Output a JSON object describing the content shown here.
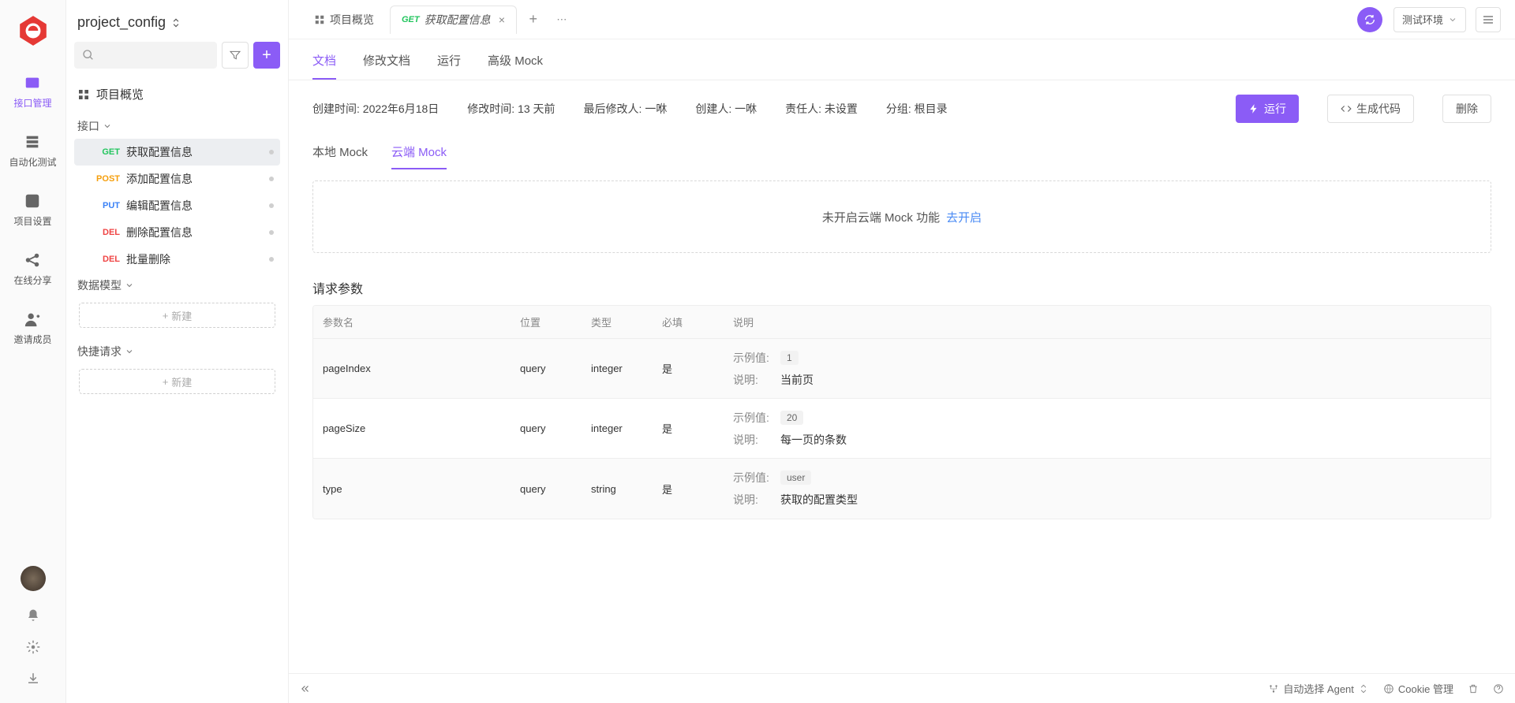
{
  "rail": {
    "items": [
      {
        "label": "接口管理"
      },
      {
        "label": "自动化测试"
      },
      {
        "label": "项目设置"
      },
      {
        "label": "在线分享"
      },
      {
        "label": "邀请成员"
      }
    ]
  },
  "project": {
    "name": "project_config"
  },
  "sidebar": {
    "overview": "项目概览",
    "apiGroup": "接口",
    "modelGroup": "数据模型",
    "quickGroup": "快捷请求",
    "newBtn": "新建",
    "apis": [
      {
        "method": "GET",
        "methodClass": "m-get",
        "name": "获取配置信息"
      },
      {
        "method": "POST",
        "methodClass": "m-post",
        "name": "添加配置信息"
      },
      {
        "method": "PUT",
        "methodClass": "m-put",
        "name": "编辑配置信息"
      },
      {
        "method": "DEL",
        "methodClass": "m-del",
        "name": "删除配置信息"
      },
      {
        "method": "DEL",
        "methodClass": "m-del",
        "name": "批量删除"
      }
    ]
  },
  "tabs": {
    "overview": "项目概览",
    "active": {
      "method": "GET",
      "title": "获取配置信息"
    },
    "env": "测试环境"
  },
  "subtabs": [
    "文档",
    "修改文档",
    "运行",
    "高级 Mock"
  ],
  "meta": {
    "created_label": "创建时间:",
    "created": "2022年6月18日",
    "modified_label": "修改时间:",
    "modified": "13 天前",
    "lastEditor_label": "最后修改人:",
    "lastEditor": "一咻",
    "creator_label": "创建人:",
    "creator": "一咻",
    "owner_label": "责任人:",
    "owner": "未设置",
    "group_label": "分组:",
    "group": "根目录"
  },
  "actions": {
    "run": "运行",
    "gen": "生成代码",
    "delete": "删除"
  },
  "mockTabs": {
    "local": "本地 Mock",
    "cloud": "云端 Mock"
  },
  "cloud": {
    "msg": "未开启云端 Mock 功能",
    "link": "去开启"
  },
  "paramsTitle": "请求参数",
  "paramsHead": {
    "name": "参数名",
    "loc": "位置",
    "type": "类型",
    "req": "必填",
    "desc": "说明"
  },
  "descLabels": {
    "example": "示例值:",
    "desc": "说明:"
  },
  "params": [
    {
      "name": "pageIndex",
      "loc": "query",
      "type": "integer",
      "req": "是",
      "example": "1",
      "desc": "当前页"
    },
    {
      "name": "pageSize",
      "loc": "query",
      "type": "integer",
      "req": "是",
      "example": "20",
      "desc": "每一页的条数"
    },
    {
      "name": "type",
      "loc": "query",
      "type": "string",
      "req": "是",
      "example": "user",
      "desc": "获取的配置类型"
    }
  ],
  "footer": {
    "agent": "自动选择 Agent",
    "cookie": "Cookie 管理"
  }
}
